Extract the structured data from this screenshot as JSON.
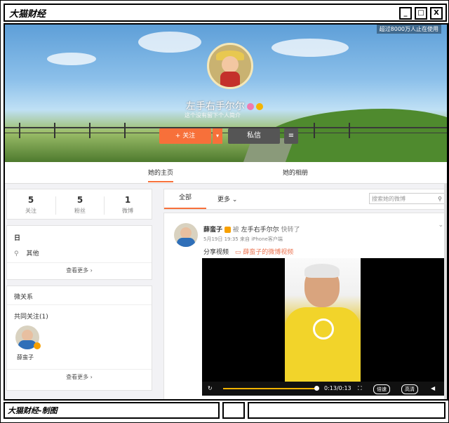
{
  "window": {
    "title": "大猫财经",
    "min_label": "_",
    "max_label": "□",
    "close_label": "X"
  },
  "banner": {
    "viewers_text": "超过8000万人止在使用"
  },
  "profile": {
    "username": "左手右手尔尔",
    "bio": "这个没有留下个人简介",
    "follow_label": "+ 关注",
    "more_label": "▾",
    "message_label": "私信",
    "menu_label": "≡"
  },
  "tabs": [
    {
      "label": "她的主页"
    },
    {
      "label": "她的相册"
    }
  ],
  "stats": [
    {
      "value": "5",
      "label": "关注"
    },
    {
      "value": "5",
      "label": "粉丝"
    },
    {
      "value": "1",
      "label": "微博"
    }
  ],
  "info": {
    "heading": "日",
    "location_label": "其他",
    "see_more": "查看更多 ›"
  },
  "relations": {
    "heading": "微关系",
    "mutual_label": "共同关注(1)",
    "mutual_name": "薛蛮子",
    "see_more": "查看更多 ›"
  },
  "feed": {
    "all_label": "全部",
    "more_label": "更多 ⌄",
    "search_placeholder": "搜索她的微博"
  },
  "post": {
    "author": "薛蛮子",
    "by_label": "被",
    "liker": "左手右手尔尔",
    "action": "快转了",
    "meta": "5月19日 19:35 来自 iPhone客户端",
    "text": "分享视频",
    "link_text": "薛蛮子的微博视频",
    "time_display": "0:13/0:13",
    "speed_label": "倍速",
    "quality_label": "高清",
    "progress": 1.0
  },
  "footer": {
    "text": "大猫财经-制图"
  },
  "colors": {
    "accent": "#f7703a",
    "progress": "#f2b400",
    "link": "#eb7350"
  }
}
